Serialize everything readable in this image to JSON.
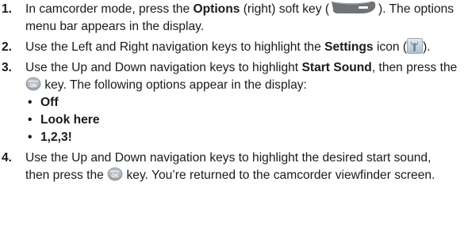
{
  "steps": [
    {
      "number": "1.",
      "parts": [
        "In camcorder mode, press the ",
        "Options",
        " (right) soft key (",
        "). The options menu bar appears in the display."
      ],
      "icon": "right-soft-key-icon"
    },
    {
      "number": "2.",
      "parts": [
        "Use the Left and Right navigation keys to highlight the ",
        "Settings",
        " icon (",
        ")."
      ],
      "icon": "settings-wrench-icon"
    },
    {
      "number": "3.",
      "parts": [
        "Use the Up and Down navigation keys to highlight ",
        "Start Sound",
        ", then press the ",
        " key. The following options appear in the display:"
      ],
      "icon": "menu-ok-key-icon",
      "options": [
        "Off",
        "Look here",
        "1,2,3!"
      ]
    },
    {
      "number": "4.",
      "parts": [
        "Use the Up and Down navigation keys to highlight the desired start sound, then press the ",
        " key. You’re returned to the camcorder viewfinder screen."
      ],
      "icon": "menu-ok-key-icon"
    }
  ],
  "icon_labels": {
    "ok_top": "MENU",
    "ok_bottom": "OK"
  },
  "colors": {
    "softkey_body": "#6f7479",
    "settings_bg": "#c9d6e2",
    "ok_key": "#9aa1a8"
  }
}
